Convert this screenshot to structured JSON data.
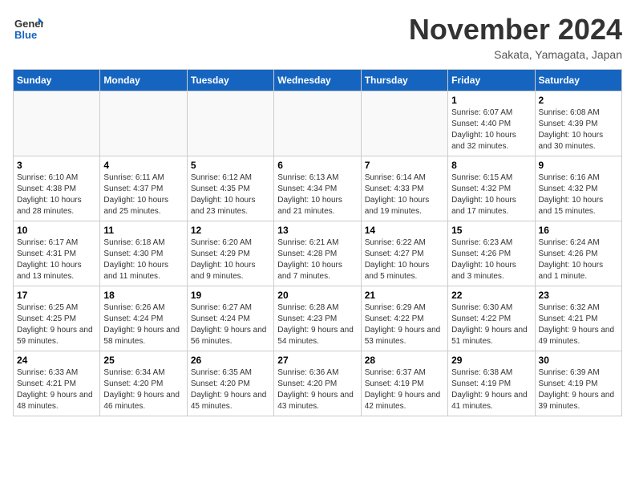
{
  "header": {
    "logo_general": "General",
    "logo_blue": "Blue",
    "month": "November 2024",
    "location": "Sakata, Yamagata, Japan"
  },
  "weekdays": [
    "Sunday",
    "Monday",
    "Tuesday",
    "Wednesday",
    "Thursday",
    "Friday",
    "Saturday"
  ],
  "weeks": [
    [
      {
        "day": "",
        "info": ""
      },
      {
        "day": "",
        "info": ""
      },
      {
        "day": "",
        "info": ""
      },
      {
        "day": "",
        "info": ""
      },
      {
        "day": "",
        "info": ""
      },
      {
        "day": "1",
        "info": "Sunrise: 6:07 AM\nSunset: 4:40 PM\nDaylight: 10 hours and 32 minutes."
      },
      {
        "day": "2",
        "info": "Sunrise: 6:08 AM\nSunset: 4:39 PM\nDaylight: 10 hours and 30 minutes."
      }
    ],
    [
      {
        "day": "3",
        "info": "Sunrise: 6:10 AM\nSunset: 4:38 PM\nDaylight: 10 hours and 28 minutes."
      },
      {
        "day": "4",
        "info": "Sunrise: 6:11 AM\nSunset: 4:37 PM\nDaylight: 10 hours and 25 minutes."
      },
      {
        "day": "5",
        "info": "Sunrise: 6:12 AM\nSunset: 4:35 PM\nDaylight: 10 hours and 23 minutes."
      },
      {
        "day": "6",
        "info": "Sunrise: 6:13 AM\nSunset: 4:34 PM\nDaylight: 10 hours and 21 minutes."
      },
      {
        "day": "7",
        "info": "Sunrise: 6:14 AM\nSunset: 4:33 PM\nDaylight: 10 hours and 19 minutes."
      },
      {
        "day": "8",
        "info": "Sunrise: 6:15 AM\nSunset: 4:32 PM\nDaylight: 10 hours and 17 minutes."
      },
      {
        "day": "9",
        "info": "Sunrise: 6:16 AM\nSunset: 4:32 PM\nDaylight: 10 hours and 15 minutes."
      }
    ],
    [
      {
        "day": "10",
        "info": "Sunrise: 6:17 AM\nSunset: 4:31 PM\nDaylight: 10 hours and 13 minutes."
      },
      {
        "day": "11",
        "info": "Sunrise: 6:18 AM\nSunset: 4:30 PM\nDaylight: 10 hours and 11 minutes."
      },
      {
        "day": "12",
        "info": "Sunrise: 6:20 AM\nSunset: 4:29 PM\nDaylight: 10 hours and 9 minutes."
      },
      {
        "day": "13",
        "info": "Sunrise: 6:21 AM\nSunset: 4:28 PM\nDaylight: 10 hours and 7 minutes."
      },
      {
        "day": "14",
        "info": "Sunrise: 6:22 AM\nSunset: 4:27 PM\nDaylight: 10 hours and 5 minutes."
      },
      {
        "day": "15",
        "info": "Sunrise: 6:23 AM\nSunset: 4:26 PM\nDaylight: 10 hours and 3 minutes."
      },
      {
        "day": "16",
        "info": "Sunrise: 6:24 AM\nSunset: 4:26 PM\nDaylight: 10 hours and 1 minute."
      }
    ],
    [
      {
        "day": "17",
        "info": "Sunrise: 6:25 AM\nSunset: 4:25 PM\nDaylight: 9 hours and 59 minutes."
      },
      {
        "day": "18",
        "info": "Sunrise: 6:26 AM\nSunset: 4:24 PM\nDaylight: 9 hours and 58 minutes."
      },
      {
        "day": "19",
        "info": "Sunrise: 6:27 AM\nSunset: 4:24 PM\nDaylight: 9 hours and 56 minutes."
      },
      {
        "day": "20",
        "info": "Sunrise: 6:28 AM\nSunset: 4:23 PM\nDaylight: 9 hours and 54 minutes."
      },
      {
        "day": "21",
        "info": "Sunrise: 6:29 AM\nSunset: 4:22 PM\nDaylight: 9 hours and 53 minutes."
      },
      {
        "day": "22",
        "info": "Sunrise: 6:30 AM\nSunset: 4:22 PM\nDaylight: 9 hours and 51 minutes."
      },
      {
        "day": "23",
        "info": "Sunrise: 6:32 AM\nSunset: 4:21 PM\nDaylight: 9 hours and 49 minutes."
      }
    ],
    [
      {
        "day": "24",
        "info": "Sunrise: 6:33 AM\nSunset: 4:21 PM\nDaylight: 9 hours and 48 minutes."
      },
      {
        "day": "25",
        "info": "Sunrise: 6:34 AM\nSunset: 4:20 PM\nDaylight: 9 hours and 46 minutes."
      },
      {
        "day": "26",
        "info": "Sunrise: 6:35 AM\nSunset: 4:20 PM\nDaylight: 9 hours and 45 minutes."
      },
      {
        "day": "27",
        "info": "Sunrise: 6:36 AM\nSunset: 4:20 PM\nDaylight: 9 hours and 43 minutes."
      },
      {
        "day": "28",
        "info": "Sunrise: 6:37 AM\nSunset: 4:19 PM\nDaylight: 9 hours and 42 minutes."
      },
      {
        "day": "29",
        "info": "Sunrise: 6:38 AM\nSunset: 4:19 PM\nDaylight: 9 hours and 41 minutes."
      },
      {
        "day": "30",
        "info": "Sunrise: 6:39 AM\nSunset: 4:19 PM\nDaylight: 9 hours and 39 minutes."
      }
    ]
  ]
}
